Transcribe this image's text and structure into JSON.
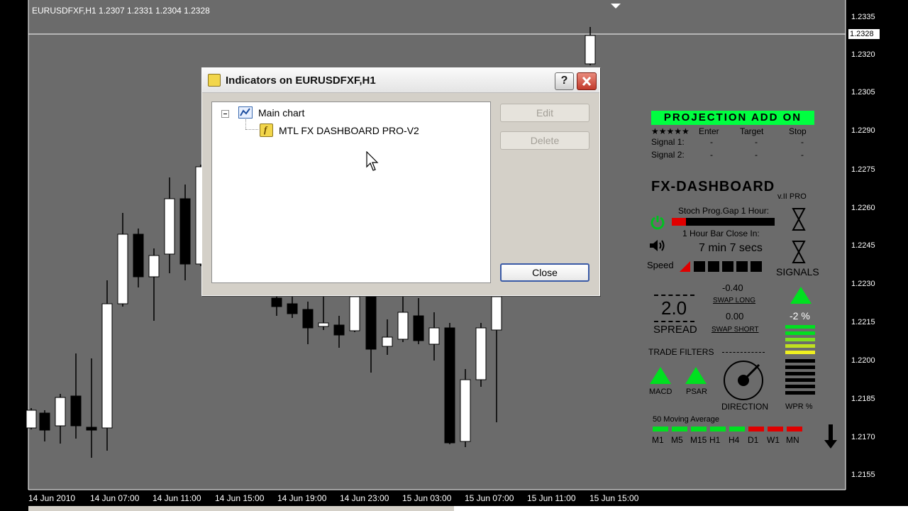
{
  "chart": {
    "title": "EURUSDFXF,H1  1.2307 1.2331 1.2304 1.2328",
    "current_price": "1.2328",
    "price_ticks": [
      "1.2335",
      "1.2320",
      "1.2305",
      "1.2290",
      "1.2275",
      "1.2260",
      "1.2245",
      "1.2230",
      "1.2215",
      "1.2200",
      "1.2185",
      "1.2170",
      "1.2155"
    ],
    "time_ticks": [
      "14 Jun 2010",
      "14 Jun 07:00",
      "14 Jun 11:00",
      "14 Jun 15:00",
      "14 Jun 19:00",
      "14 Jun 23:00",
      "15 Jun 03:00",
      "15 Jun 07:00",
      "15 Jun 11:00",
      "15 Jun 15:00"
    ]
  },
  "dialog": {
    "title": "Indicators on EURUSDFXF,H1",
    "help_label": "?",
    "tree": {
      "root": "Main chart",
      "child": "MTL FX DASHBOARD PRO-V2"
    },
    "edit_label": "Edit",
    "delete_label": "Delete",
    "close_label": "Close"
  },
  "dashboard": {
    "projection_title": "PROJECTION ADD ON",
    "proj_headers": [
      "★★★★★",
      "Enter",
      "Target",
      "Stop"
    ],
    "signal1_label": "Signal 1:",
    "signal2_label": "Signal 2:",
    "dash": "-",
    "logo": "FX-DASHBOARD",
    "version": "v.II PRO",
    "stoch_label": "Stoch Prog.Gap 1 Hour:",
    "bar_close_label": "1 Hour Bar Close In:",
    "bar_close_value": "7 min 7 secs",
    "speed_label": "Speed",
    "signals_label": "SIGNALS",
    "spread_value": "2.0",
    "spread_label": "SPREAD",
    "swap_long_value": "-0.40",
    "swap_long_label": "SWAP LONG",
    "swap_short_value": "0.00",
    "swap_short_label": "SWAP SHORT",
    "signal_pct": "-2 %",
    "trade_filters_label": "TRADE FILTERS",
    "macd_label": "MACD",
    "psar_label": "PSAR",
    "direction_label": "DIRECTION",
    "wpr_label": "WPR %",
    "ma_label": "50 Moving Average",
    "timeframes": [
      "M1",
      "M5",
      "M15",
      "H1",
      "H4",
      "D1",
      "W1",
      "MN"
    ],
    "timeframe_colors": [
      "#00e020",
      "#00e020",
      "#00e020",
      "#00e020",
      "#00e020",
      "#e00000",
      "#e00000",
      "#e00000"
    ],
    "colors": {
      "accent": "#00ff40",
      "bull": "#00e020",
      "bear": "#e00000",
      "chart_bg": "#6b6b6b"
    }
  }
}
